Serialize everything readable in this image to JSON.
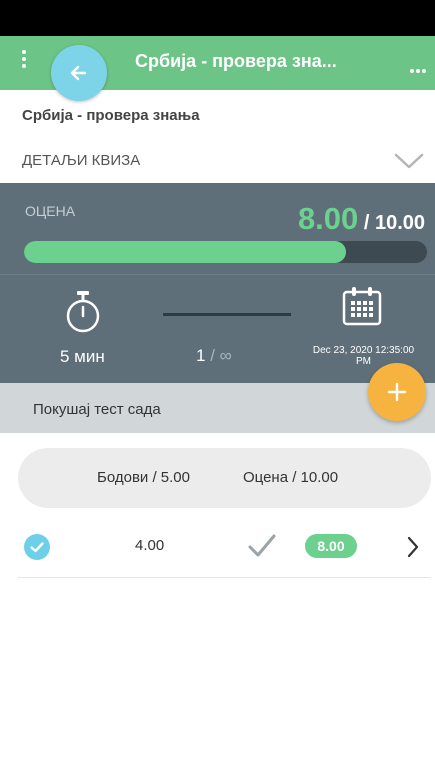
{
  "app_bar": {
    "title": "Србија - провера зна...",
    "menu_icon": "kebab-vertical-icon",
    "more_icon": "kebab-horizontal-icon",
    "back_icon": "arrow-left-icon"
  },
  "quiz": {
    "name": "Србија - провера знања",
    "details_label": "ДЕТАЉИ КВИЗА"
  },
  "grade": {
    "label": "ОЦЕНА",
    "value": "8.00",
    "max": " / 10.00",
    "fill_fraction": 0.8
  },
  "stats": {
    "duration": "5 мин",
    "attempts_used": "1",
    "attempts_sep": " / ",
    "attempts_max": "∞",
    "date_line1": "Dec 23, 2020 12:35:00",
    "date_line2": "PM"
  },
  "try_now": {
    "label": "Покушај тест сада",
    "fab_icon": "plus-icon"
  },
  "results": {
    "headers": {
      "points": "Бодови / 5.00",
      "grade": "Оцена / 10.00"
    },
    "rows": [
      {
        "points": "4.00",
        "grade": "8.00"
      }
    ]
  },
  "colors": {
    "app_bar": "#6cc487",
    "accent_green": "#6cd08e",
    "panel": "#5e6f79",
    "fab_orange": "#f7b340",
    "fab_blue": "#7dd3e8"
  }
}
